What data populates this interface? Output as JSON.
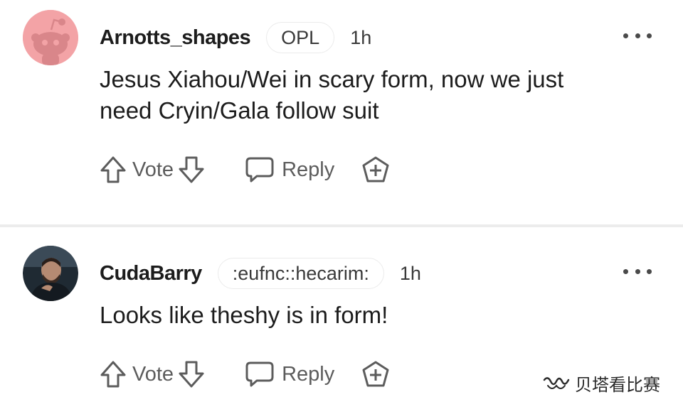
{
  "comments": [
    {
      "username": "Arnotts_shapes",
      "flair": "OPL",
      "time": "1h",
      "body_line1": "Jesus Xiahou/Wei in scary form, now we just",
      "body_line2": "need Cryin/Gala follow suit",
      "avatar": "reddit-snoo-icon",
      "avatar_color": "#f3a3a6"
    },
    {
      "username": "CudaBarry",
      "flair": ":eufnc::hecarim:",
      "time": "1h",
      "body_line1": "Looks like theshy is in form!",
      "avatar": "user-photo"
    }
  ],
  "actions": {
    "vote_label": "Vote",
    "reply_label": "Reply",
    "more_icon": "more-dots-icon",
    "upvote_icon": "upvote-arrow-icon",
    "downvote_icon": "downvote-arrow-icon",
    "reply_icon": "speech-bubble-icon",
    "award_icon": "award-plus-icon"
  },
  "watermark": {
    "text": "贝塔看比赛",
    "icon": "wechat-channel-icon"
  },
  "colors": {
    "text": "#1c1c1c",
    "muted": "#5c5c5c",
    "divider": "#ececec",
    "avatar_pink": "#f3a3a6"
  }
}
